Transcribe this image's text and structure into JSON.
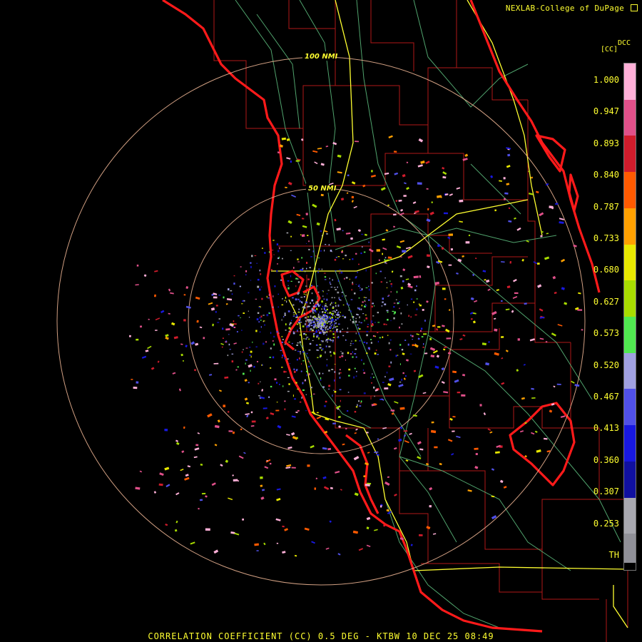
{
  "credit": "NEXLAB-College of DuPage",
  "legend": {
    "product": "DCC",
    "unit": "[CC]",
    "ticks": [
      "1.000",
      "0.947",
      "0.893",
      "0.840",
      "0.787",
      "0.733",
      "0.680",
      "0.627",
      "0.573",
      "0.520",
      "0.467",
      "0.413",
      "0.360",
      "0.307",
      "0.253",
      "TH"
    ]
  },
  "range_rings": [
    {
      "label": "100 NMI"
    },
    {
      "label": "50 NMI"
    }
  ],
  "footer": "CORRELATION COEFFICIENT (CC) 0.5 DEG - KTBW 10 DEC 25 08:49",
  "colors": {
    "coast": "#ff1a1a",
    "county": "#b01818",
    "highway": "#ffff30",
    "road": "#5fc080",
    "ring": "#e8b090",
    "text": "#ffff30",
    "palette": [
      "#ffb0d8",
      "#e0508a",
      "#d01c2c",
      "#ff5a00",
      "#ffa000",
      "#e8e800",
      "#a8dc00",
      "#50e850",
      "#a0a0e0",
      "#5050e8",
      "#1818e0",
      "#1010a0",
      "#a8a8b0",
      "#909098"
    ]
  }
}
